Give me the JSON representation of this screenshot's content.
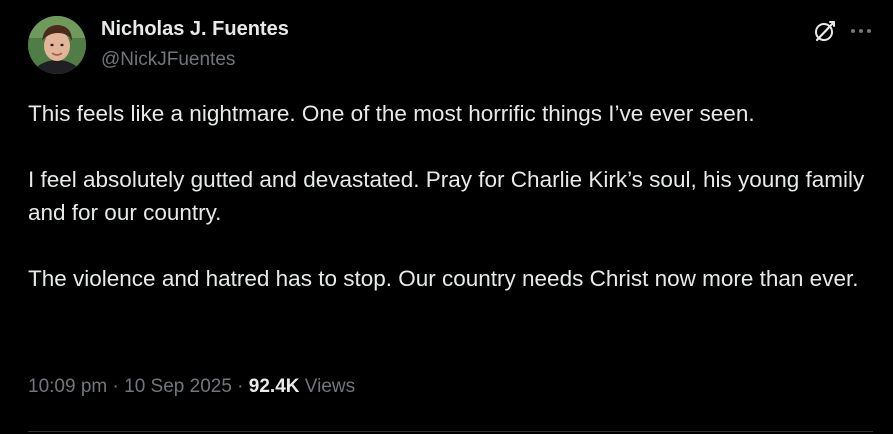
{
  "author": {
    "name": "Nicholas J. Fuentes",
    "handle": "@NickJFuentes"
  },
  "tweet": {
    "paragraphs": [
      "This feels like a nightmare. One of the most horrific things I’ve ever seen.",
      "I feel absolutely gutted and devastated. Pray for Charlie Kirk’s soul, his young family and for our country.",
      "The violence and hatred has to stop. Our country needs Christ now more than ever."
    ],
    "time": "10:09 pm",
    "date": "10 Sep 2025",
    "separator": "·",
    "views_count": "92.4K",
    "views_label": "Views"
  },
  "icons": {
    "grok": "grok-icon",
    "more": "more-icon"
  },
  "colors": {
    "background": "#000000",
    "text_primary": "#e7e9ea",
    "text_secondary": "#71767b",
    "divider": "#2f3336"
  }
}
